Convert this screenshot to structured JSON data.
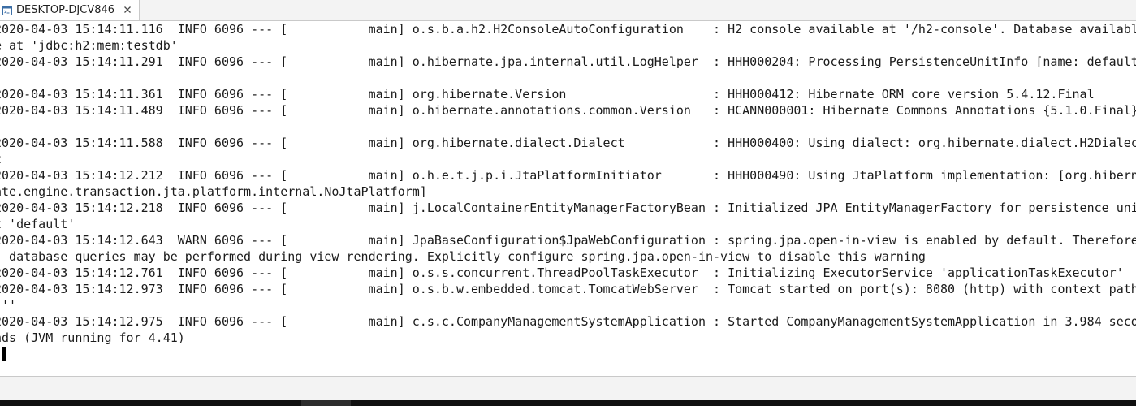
{
  "tab": {
    "title": "DESKTOP-DJCV846",
    "icon": "console-icon",
    "close_icon": "close-icon"
  },
  "console": {
    "lines": [
      "2020-04-03 15:14:11.116  INFO 6096 --- [           main] o.s.b.a.h2.H2ConsoleAutoConfiguration    : H2 console available at '/h2-console'. Database availabl",
      "e at 'jdbc:h2:mem:testdb'",
      "2020-04-03 15:14:11.291  INFO 6096 --- [           main] o.hibernate.jpa.internal.util.LogHelper  : HHH000204: Processing PersistenceUnitInfo [name: default",
      "]",
      "2020-04-03 15:14:11.361  INFO 6096 --- [           main] org.hibernate.Version                    : HHH000412: Hibernate ORM core version 5.4.12.Final",
      "2020-04-03 15:14:11.489  INFO 6096 --- [           main] o.hibernate.annotations.common.Version   : HCANN000001: Hibernate Commons Annotations {5.1.0.Final}",
      "",
      "2020-04-03 15:14:11.588  INFO 6096 --- [           main] org.hibernate.dialect.Dialect            : HHH000400: Using dialect: org.hibernate.dialect.H2Dialec",
      "t",
      "2020-04-03 15:14:12.212  INFO 6096 --- [           main] o.h.e.t.j.p.i.JtaPlatformInitiator       : HHH000490: Using JtaPlatform implementation: [org.hibern",
      "ate.engine.transaction.jta.platform.internal.NoJtaPlatform]",
      "2020-04-03 15:14:12.218  INFO 6096 --- [           main] j.LocalContainerEntityManagerFactoryBean : Initialized JPA EntityManagerFactory for persistence uni",
      "t 'default'",
      "2020-04-03 15:14:12.643  WARN 6096 --- [           main] JpaBaseConfiguration$JpaWebConfiguration : spring.jpa.open-in-view is enabled by default. Therefore",
      ", database queries may be performed during view rendering. Explicitly configure spring.jpa.open-in-view to disable this warning",
      "2020-04-03 15:14:12.761  INFO 6096 --- [           main] o.s.s.concurrent.ThreadPoolTaskExecutor  : Initializing ExecutorService 'applicationTaskExecutor'",
      "2020-04-03 15:14:12.973  INFO 6096 --- [           main] o.s.b.w.embedded.tomcat.TomcatWebServer  : Tomcat started on port(s): 8080 (http) with context path",
      " ''",
      "2020-04-03 15:14:12.975  INFO 6096 --- [           main] c.s.c.CompanyManagementSystemApplication : Started CompanyManagementSystemApplication in 3.984 seco",
      "nds (JVM running for 4.41)"
    ]
  },
  "colors": {
    "text": "#1b1b1b",
    "background": "#ffffff",
    "chrome": "#f3f3f3",
    "border": "#c9c9c9",
    "cursor": "#000000"
  }
}
